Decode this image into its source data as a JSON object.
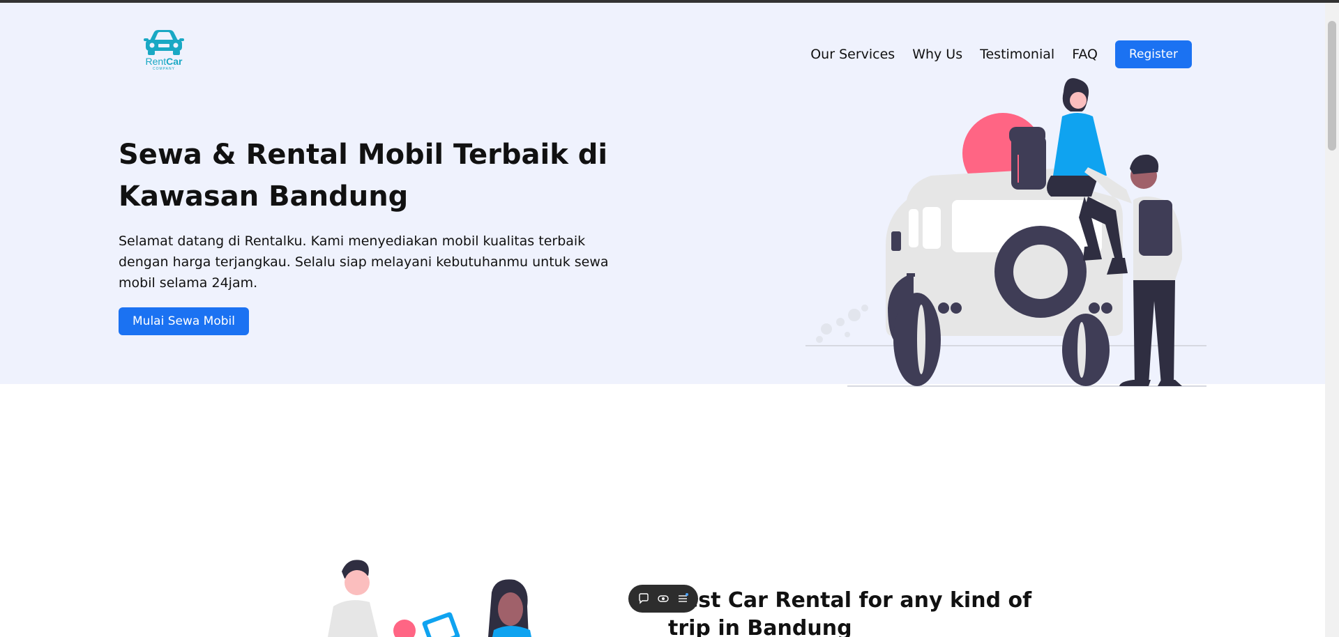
{
  "brand": {
    "name_part1": "Rent",
    "name_part2": "Car",
    "tagline": "COMPANY"
  },
  "nav": {
    "items": [
      {
        "label": "Our Services"
      },
      {
        "label": "Why Us"
      },
      {
        "label": "Testimonial"
      },
      {
        "label": "FAQ"
      }
    ],
    "register_label": "Register"
  },
  "hero": {
    "title": "Sewa & Rental Mobil Terbaik di Kawasan Bandung",
    "description": "Selamat datang di Rentalku. Kami menyediakan mobil kualitas terbaik dengan harga terjangkau. Selalu siap melayani kebutuhanmu untuk sewa mobil selama 24jam.",
    "cta_label": "Mulai Sewa Mobil"
  },
  "section2": {
    "title": "Best Car Rental for any kind of trip in Bandung"
  },
  "colors": {
    "hero_bg": "#eff2fd",
    "primary": "#1b72f2",
    "brand": "#19a8c4",
    "accent_pink": "#ff6584",
    "accent_blue": "#0fa3f0",
    "dark": "#3f3d56"
  },
  "toolbar": {
    "icons": [
      "chat-icon",
      "eye-icon",
      "menu-icon"
    ]
  }
}
